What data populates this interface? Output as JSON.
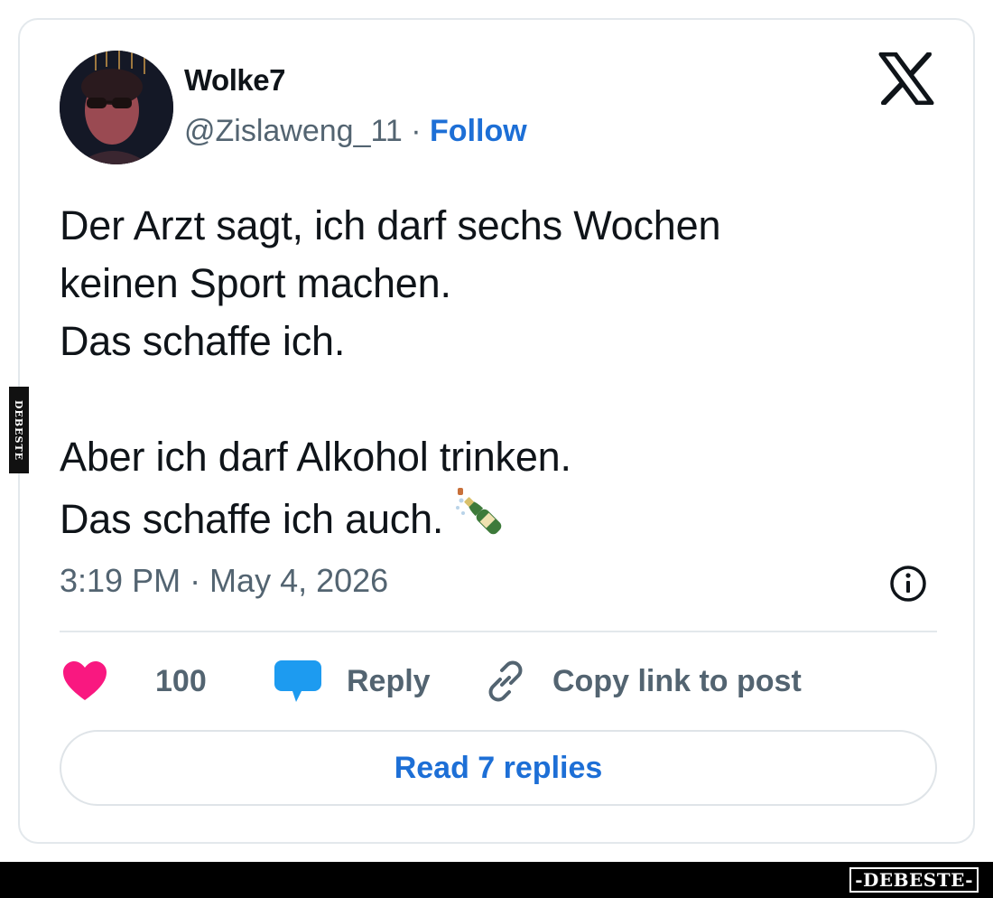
{
  "tweet": {
    "author_name": "Wolke7",
    "handle": "@Zislaweng_11",
    "separator": "·",
    "follow_label": "Follow",
    "text": "Der Arzt sagt, ich darf sechs Wochen\nkeinen Sport machen.\nDas schaffe ich.\n\nAber ich darf Alkohol trinken.\nDas schaffe ich auch.",
    "emoji_icon": "champagne-bottle-icon",
    "timestamp": "3:19 PM · May 4, 2026",
    "actions": {
      "like_count": "100",
      "reply_label": "Reply",
      "copy_link_label": "Copy link to post"
    },
    "read_replies_label": "Read 7 replies"
  },
  "icons": {
    "brand": "x-logo-icon",
    "info": "info-icon",
    "like": "heart-icon",
    "reply": "speech-bubble-icon",
    "copy_link": "link-icon"
  },
  "watermark": {
    "side_text": "DEBESTE",
    "footer_text": "-DEBESTE-"
  },
  "colors": {
    "link_blue": "#1d6fd6",
    "heart_pink": "#f91880",
    "reply_blue": "#1d9bf0",
    "secondary_text": "#536471",
    "border": "#e3e8ec"
  }
}
